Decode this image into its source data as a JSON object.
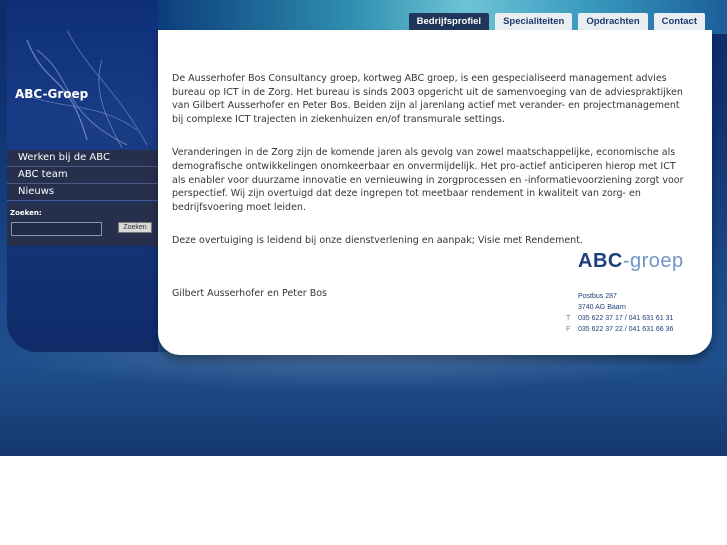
{
  "brand": {
    "name": "ABC-Groep"
  },
  "nav": {
    "tabs": [
      {
        "label": "Bedrijfsprofiel"
      },
      {
        "label": "Specialiteiten"
      },
      {
        "label": "Opdrachten"
      },
      {
        "label": "Contact"
      }
    ]
  },
  "sidebar": {
    "items": [
      {
        "label": "Werken bij de ABC"
      },
      {
        "label": "ABC team"
      },
      {
        "label": "Nieuws"
      }
    ],
    "search": {
      "label": "Zoeken:",
      "value": "",
      "button": "Zoeken"
    }
  },
  "main": {
    "paragraphs": [
      "De Ausserhofer Bos Consultancy groep, kortweg ABC groep, is een gespecialiseerd management advies bureau op ICT in de Zorg.  Het bureau is sinds 2003 opgericht uit de samenvoeging van de adviespraktijken van Gilbert Ausserhofer en Peter Bos. Beiden zijn al jarenlang actief met verander- en projectmanagement bij complexe ICT trajecten in ziekenhuizen en/of transmurale settings.",
      "Veranderingen in de Zorg zijn de komende jaren als gevolg van zowel maatschappelijke, economische als demografische ontwikkelingen onomkeerbaar en onvermijdelijk. Het pro-actief anticiperen hierop met ICT als enabler voor duurzame innovatie en vernieuwing in zorgprocessen en -informatievoorziening zorgt voor perspectief. Wij zijn overtuigd dat deze ingrepen tot meetbaar rendement in kwaliteit van zorg- en bedrijfsvoering moet leiden.",
      "Deze overtuiging is leidend bij onze dienstverlening en aanpak; Visie met Rendement."
    ],
    "signature": "Gilbert Ausserhofer en Peter Bos"
  },
  "contact": {
    "logo_main": "ABC",
    "logo_sep": "-",
    "logo_sub": "groep",
    "address_line1": "Postbus 287",
    "address_line2": "3740 AG Baarn",
    "phone_label": "T",
    "phone": "035 622 37 17 / 041 631 61 31",
    "fax_label": "F",
    "fax": "035 622 37 22 / 041 631 66 36"
  },
  "colors": {
    "accent": "#1f3559",
    "panel": "#ffffff",
    "background": "#123575"
  }
}
